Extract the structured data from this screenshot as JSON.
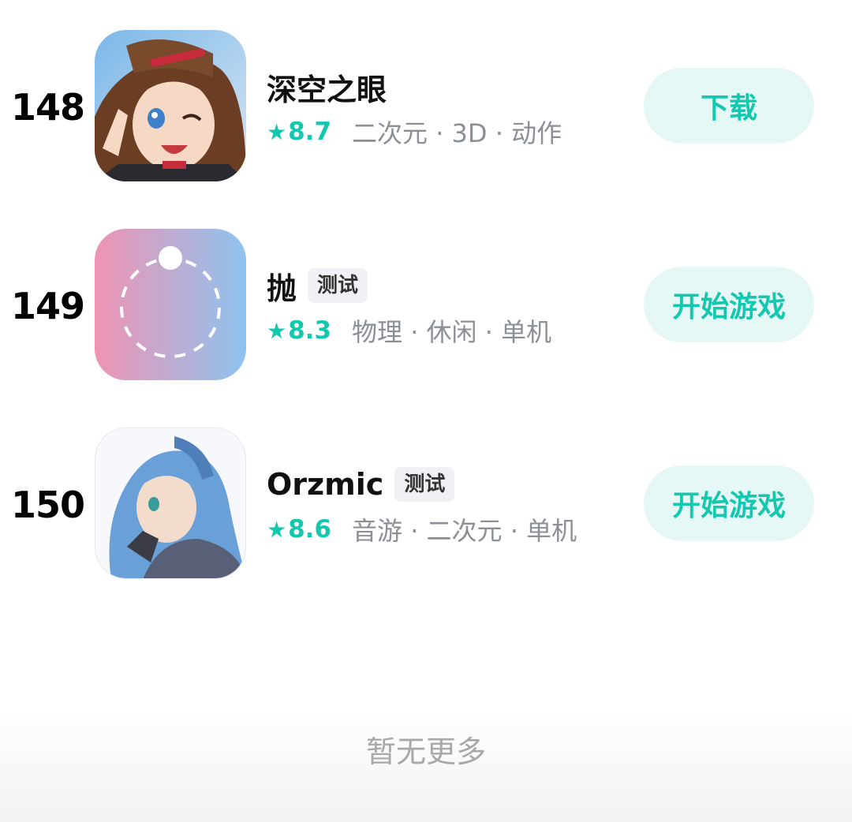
{
  "games": [
    {
      "rank": "148",
      "name": "深空之眼",
      "tag": "",
      "star": "★",
      "score": "8.7",
      "genres": "二次元 · 3D · 动作",
      "button": "下载",
      "icon": "anime-character-icon"
    },
    {
      "rank": "149",
      "name": "抛",
      "tag": "测试",
      "star": "★",
      "score": "8.3",
      "genres": "物理 · 休闲 · 单机",
      "button": "开始游戏",
      "icon": "dashed-circle-icon"
    },
    {
      "rank": "150",
      "name": "Orzmic",
      "tag": "测试",
      "star": "★",
      "score": "8.6",
      "genres": "音游 · 二次元 · 单机",
      "button": "开始游戏",
      "icon": "blue-hair-character-icon"
    }
  ],
  "footer": {
    "no_more": "暂无更多"
  },
  "colors": {
    "accent": "#14c8b0",
    "button_bg": "#e6f8f5",
    "muted": "#8b8f96"
  }
}
